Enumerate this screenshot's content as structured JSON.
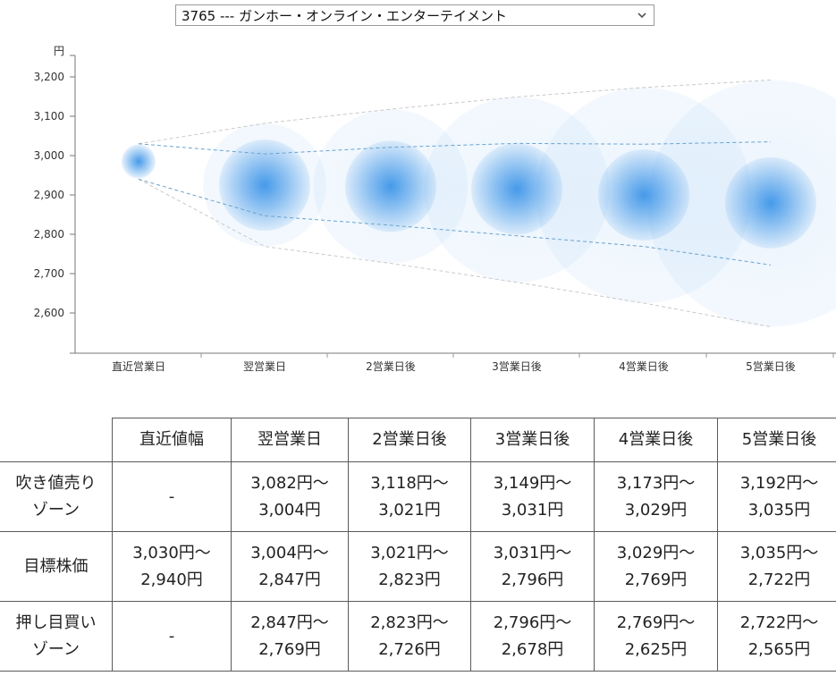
{
  "selector": {
    "value": "3765 --- ガンホー・オンライン・エンターテイメント",
    "icon": "chevron-down-icon"
  },
  "chart_data": {
    "type": "scatter",
    "y_unit": "円",
    "ylim": [
      2560,
      3250
    ],
    "y_ticks": [
      2600,
      2700,
      2800,
      2900,
      3000,
      3100,
      3200
    ],
    "y_tick_labels": [
      "2,600",
      "2,700",
      "2,800",
      "2,900",
      "3,000",
      "3,100",
      "3,200"
    ],
    "categories": [
      "直近営業日",
      "翌営業日",
      "2営業日後",
      "3営業日後",
      "4営業日後",
      "5営業日後"
    ],
    "center": [
      2985,
      2925,
      2922,
      2915,
      2900,
      2880
    ],
    "inner_upper": [
      3030,
      3004,
      3021,
      3031,
      3029,
      3035
    ],
    "inner_lower": [
      2940,
      2847,
      2823,
      2796,
      2769,
      2722
    ],
    "outer_upper": [
      3030,
      3082,
      3118,
      3149,
      3173,
      3192
    ],
    "outer_lower": [
      2940,
      2769,
      2726,
      2678,
      2625,
      2565
    ],
    "colors": {
      "bubble": "#3d95e8",
      "inner_line": "#6aa3cf",
      "outer_line": "#c9c9c9"
    }
  },
  "table": {
    "headers": [
      "",
      "直近値幅",
      "翌営業日",
      "2営業日後",
      "3営業日後",
      "4営業日後",
      "5営業日後"
    ],
    "rows": [
      {
        "label": [
          "吹き値売り",
          "ゾーン"
        ],
        "cells": [
          [
            "-"
          ],
          [
            "3,082円〜",
            "3,004円"
          ],
          [
            "3,118円〜",
            "3,021円"
          ],
          [
            "3,149円〜",
            "3,031円"
          ],
          [
            "3,173円〜",
            "3,029円"
          ],
          [
            "3,192円〜",
            "3,035円"
          ]
        ]
      },
      {
        "label": [
          "目標株価"
        ],
        "cells": [
          [
            "3,030円〜",
            "2,940円"
          ],
          [
            "3,004円〜",
            "2,847円"
          ],
          [
            "3,021円〜",
            "2,823円"
          ],
          [
            "3,031円〜",
            "2,796円"
          ],
          [
            "3,029円〜",
            "2,769円"
          ],
          [
            "3,035円〜",
            "2,722円"
          ]
        ]
      },
      {
        "label": [
          "押し目買い",
          "ゾーン"
        ],
        "cells": [
          [
            "-"
          ],
          [
            "2,847円〜",
            "2,769円"
          ],
          [
            "2,823円〜",
            "2,726円"
          ],
          [
            "2,796円〜",
            "2,678円"
          ],
          [
            "2,769円〜",
            "2,625円"
          ],
          [
            "2,722円〜",
            "2,565円"
          ]
        ]
      }
    ]
  }
}
